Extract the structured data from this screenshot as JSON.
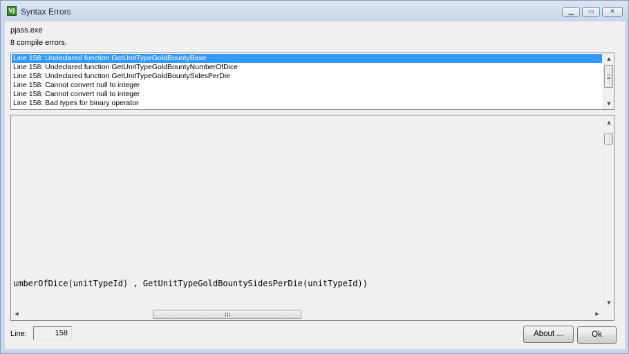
{
  "window": {
    "title": "Syntax Errors",
    "app_icon": "vj-app-icon"
  },
  "caption_buttons": {
    "minimize": "minimize-icon",
    "maximize": "maximize-icon",
    "close": "close-icon"
  },
  "header": {
    "exe": "pjass.exe",
    "summary": "8 compile errors."
  },
  "errors": [
    "Line 158:  Undeclared function GetUnitTypeGoldBountyBase",
    "Line 158:  Undeclared function GetUnitTypeGoldBountyNumberOfDice",
    "Line 158:  Undeclared function GetUnitTypeGoldBountySidesPerDie",
    "Line 158:  Cannot convert null to integer",
    "Line 158:  Cannot convert null to integer",
    "Line 158:  Bad types for binary operator"
  ],
  "selected_error_index": 0,
  "code": {
    "visible_line": "umberOfDice(unitTypeId) , GetUnitTypeGoldBountySidesPerDie(unitTypeId))"
  },
  "footer": {
    "line_label": "Line:",
    "line_value": "158"
  },
  "buttons": {
    "about": "About ...",
    "ok": "Ok"
  },
  "colors": {
    "selection": "#3399ff",
    "titlebar": "#c9d8ea"
  }
}
